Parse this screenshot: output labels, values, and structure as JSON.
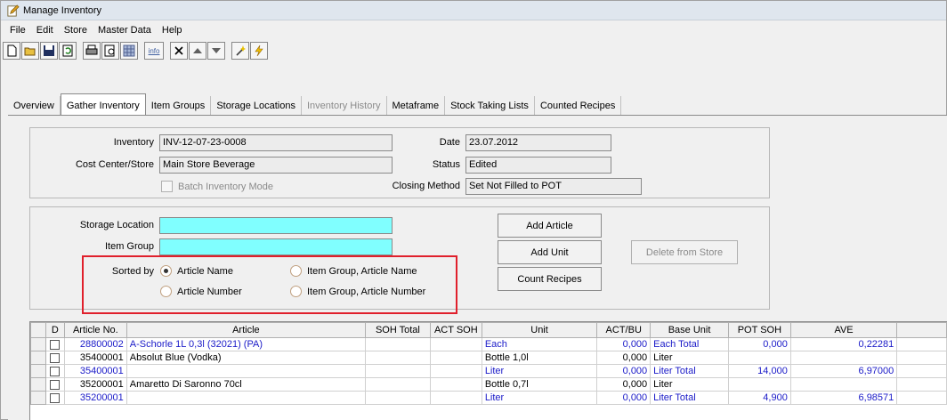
{
  "window": {
    "title": "Manage Inventory"
  },
  "menu": [
    {
      "label": "File"
    },
    {
      "label": "Edit"
    },
    {
      "label": "Store"
    },
    {
      "label": "Master Data"
    },
    {
      "label": "Help"
    }
  ],
  "toolbar": {
    "icons": [
      "new-icon",
      "open-icon",
      "save-icon",
      "refresh-icon",
      "print-icon",
      "print-preview-icon",
      "grid-icon",
      "info-icon",
      "delete-icon",
      "move-up-icon",
      "move-down-icon",
      "wand-icon",
      "lightning-icon"
    ],
    "info_label": "info"
  },
  "tabs": [
    {
      "label": "Overview"
    },
    {
      "label": "Gather Inventory"
    },
    {
      "label": "Item Groups"
    },
    {
      "label": "Storage Locations"
    },
    {
      "label": "Inventory History"
    },
    {
      "label": "Metaframe"
    },
    {
      "label": "Stock Taking Lists"
    },
    {
      "label": "Counted Recipes"
    }
  ],
  "header": {
    "inventory_label": "Inventory",
    "inventory_value": "INV-12-07-23-0008",
    "cost_center_label": "Cost Center/Store",
    "cost_center_value": "Main Store Beverage",
    "batch_label": "Batch Inventory Mode",
    "date_label": "Date",
    "date_value": "23.07.2012",
    "status_label": "Status",
    "status_value": "Edited",
    "closing_label": "Closing Method",
    "closing_value": "Set Not Filled to POT"
  },
  "filters": {
    "storage_label": "Storage Location",
    "storage_value": "",
    "item_group_label": "Item Group",
    "item_group_value": "",
    "sorted_by_label": "Sorted by",
    "radio_article_name": "Article Name",
    "radio_article_number": "Article Number",
    "radio_group_name": "Item Group, Article Name",
    "radio_group_number": "Item Group, Article Number"
  },
  "buttons": {
    "add_article": "Add Article",
    "add_unit": "Add Unit",
    "count_recipes": "Count Recipes",
    "delete_from_store": "Delete from Store"
  },
  "grid": {
    "columns": [
      "D",
      "Article No.",
      "Article",
      "SOH Total",
      "ACT SOH",
      "Unit",
      "ACT/BU",
      "Base Unit",
      "POT SOH",
      "AVE"
    ],
    "rows": [
      {
        "article_no": "28800002",
        "article": "A-Schorle 1L 0,3l (32021) (PA)",
        "soh_total": "",
        "act_soh": "",
        "unit": "Each",
        "act_bu": "0,000",
        "base_unit": "Each  Total",
        "pot_soh": "0,000",
        "ave": "0,22281",
        "total": true
      },
      {
        "article_no": "35400001",
        "article": "Absolut Blue (Vodka)",
        "soh_total": "",
        "act_soh": "",
        "unit": "Bottle 1,0l",
        "act_bu": "0,000",
        "base_unit": "Liter",
        "pot_soh": "",
        "ave": "",
        "total": false
      },
      {
        "article_no": "35400001",
        "article": "",
        "soh_total": "",
        "act_soh": "",
        "unit": "Liter",
        "act_bu": "0,000",
        "base_unit": "Liter  Total",
        "pot_soh": "14,000",
        "ave": "6,97000",
        "total": true
      },
      {
        "article_no": "35200001",
        "article": "Amaretto Di Saronno 70cl",
        "soh_total": "",
        "act_soh": "",
        "unit": "Bottle 0,7l",
        "act_bu": "0,000",
        "base_unit": "Liter",
        "pot_soh": "",
        "ave": "",
        "total": false
      },
      {
        "article_no": "35200001",
        "article": "",
        "soh_total": "",
        "act_soh": "",
        "unit": "Liter",
        "act_bu": "0,000",
        "base_unit": "Liter  Total",
        "pot_soh": "4,900",
        "ave": "6,98571",
        "total": true
      }
    ]
  }
}
